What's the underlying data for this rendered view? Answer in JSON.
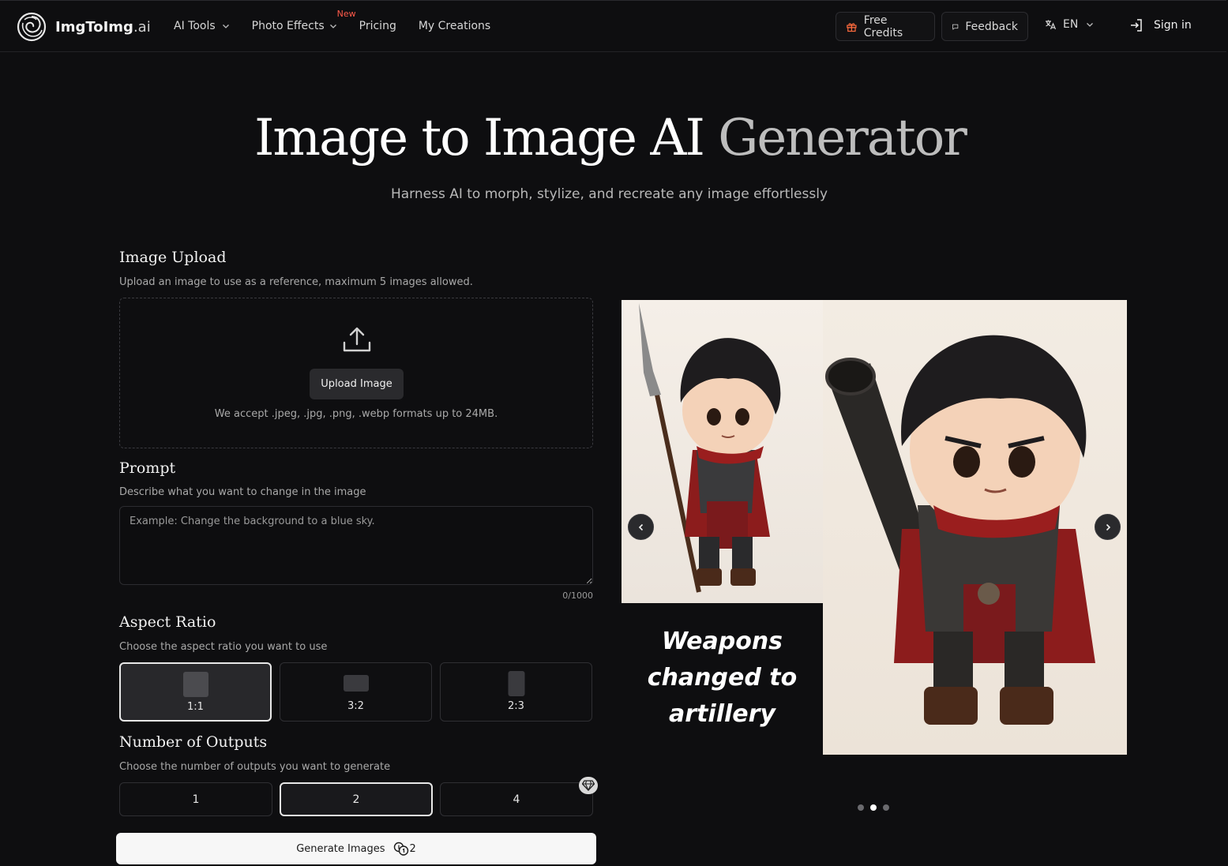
{
  "header": {
    "logo": {
      "brand": "ImgToImg",
      "suffix": ".ai"
    },
    "nav": [
      {
        "label": "AI Tools"
      },
      {
        "label": "Photo Effects",
        "badge": "New"
      },
      {
        "label": "Pricing"
      },
      {
        "label": "My Creations"
      }
    ],
    "free_credits_label": "Free Credits",
    "feedback_label": "Feedback",
    "language": "EN",
    "sign_in_label": "Sign in"
  },
  "hero": {
    "title_main": "Image to Image AI ",
    "title_fade": "Generator",
    "subtitle": "Harness AI to morph, stylize, and recreate any image effortlessly"
  },
  "upload": {
    "title": "Image Upload",
    "description": "Upload an image to use as a reference, maximum 5 images allowed.",
    "button_label": "Upload Image",
    "accept_text": "We accept .jpeg, .jpg, .png, .webp formats up to 24MB."
  },
  "prompt": {
    "title": "Prompt",
    "description": "Describe what you want to change in the image",
    "placeholder": "Example: Change the background to a blue sky.",
    "value": "",
    "counter": "0/1000"
  },
  "aspect_ratio": {
    "title": "Aspect Ratio",
    "description": "Choose the aspect ratio you want to use",
    "options": [
      {
        "label": "1:1"
      },
      {
        "label": "3:2"
      },
      {
        "label": "2:3"
      }
    ],
    "selected": "1:1"
  },
  "outputs": {
    "title": "Number of Outputs",
    "description": "Choose the number of outputs you want to generate",
    "options": [
      {
        "label": "1"
      },
      {
        "label": "2"
      },
      {
        "label": "4"
      }
    ],
    "selected": "2"
  },
  "generate": {
    "label": "Generate Images",
    "credits": "2"
  },
  "showcase": {
    "caption_lines": [
      "Weapons",
      "changed to",
      "artillery"
    ],
    "slides_total": 3,
    "active_slide": 2
  },
  "colors": {
    "background": "#0e0e10",
    "new_badge": "#ff5a4a",
    "gift_icon": "#ff6b3d"
  }
}
